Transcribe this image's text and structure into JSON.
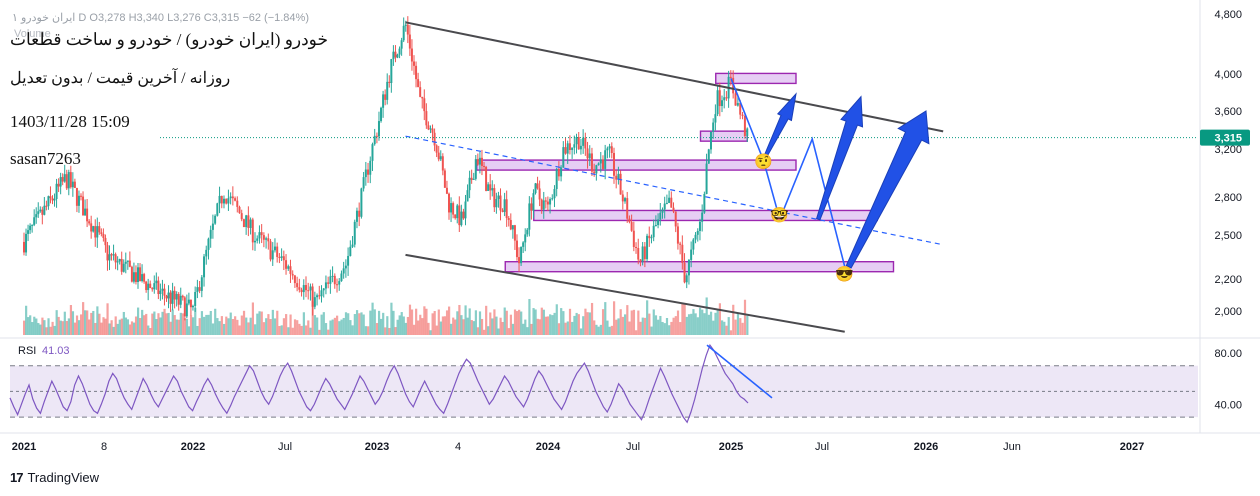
{
  "header": {
    "symbol_line": "خودرو (ایران خودرو) / خودرو و ساخت قطعات",
    "timeframe_line": "روزانه / آخرین قیمت / بدون تعدیل",
    "datetime": "1403/11/28 15:09",
    "author": "sasan7263",
    "ohlc_line": "ایران خودرو ۱ D  O3,278  H3,340  L3,276  C3,315  −62 (−1.84%)",
    "volume_label": "Volume"
  },
  "branding": {
    "logo": "17",
    "name": "TradingView"
  },
  "colors": {
    "candle_up": "#26a69a",
    "candle_down": "#ef5350",
    "channel": "#4a4a4e",
    "trend": "#2962ff",
    "zone_fill": "#e2c6f2",
    "zone_border": "#9c27b0",
    "arrow": "#2151e6",
    "rsi_line": "#7e57c2",
    "rsi_band": "#ede7f6",
    "last_price": "#089981"
  },
  "chart_data": [
    {
      "type": "candlestick",
      "x_ticks": [
        "2021",
        "8",
        "2022",
        "Jul",
        "2023",
        "4",
        "2024",
        "Jul",
        "2025",
        "Jul",
        "2026",
        "Jun",
        "2027"
      ],
      "y_ticks": [
        "4,800",
        "4,000",
        "3,600",
        "3,200",
        "2,800",
        "2,500",
        "2,200",
        "2,000"
      ],
      "ylim": [
        1880,
        4800
      ],
      "last_price": "3,315",
      "price_path": [
        [
          "2021-01",
          2450
        ],
        [
          "2021-04",
          2950
        ],
        [
          "2021-07",
          2350
        ],
        [
          "2021-10",
          2150
        ],
        [
          "2022-01",
          2000
        ],
        [
          "2022-03",
          2850
        ],
        [
          "2022-05",
          2500
        ],
        [
          "2022-07",
          2300
        ],
        [
          "2022-09",
          2050
        ],
        [
          "2022-11",
          2300
        ],
        [
          "2022-12",
          2800
        ],
        [
          "2023-01",
          3400
        ],
        [
          "2023-02",
          4100
        ],
        [
          "2023-03",
          4650
        ],
        [
          "2023-04",
          3700
        ],
        [
          "2023-05",
          3350
        ],
        [
          "2023-06",
          2750
        ],
        [
          "2023-07",
          2600
        ],
        [
          "2023-08",
          3150
        ],
        [
          "2023-09",
          2800
        ],
        [
          "2023-10",
          2750
        ],
        [
          "2023-11",
          2300
        ],
        [
          "2023-12",
          2850
        ],
        [
          "2024-01",
          2700
        ],
        [
          "2024-02",
          3200
        ],
        [
          "2024-03",
          3300
        ],
        [
          "2024-04",
          3050
        ],
        [
          "2024-05",
          3150
        ],
        [
          "2024-06",
          2750
        ],
        [
          "2024-07",
          2300
        ],
        [
          "2024-08",
          2550
        ],
        [
          "2024-09",
          2750
        ],
        [
          "2024-10",
          2200
        ],
        [
          "2024-11",
          2600
        ],
        [
          "2024-12",
          3700
        ],
        [
          "2025-01",
          3900
        ],
        [
          "2025-02",
          3315
        ]
      ],
      "zones": [
        {
          "from": "2024-12",
          "to": "2025-05",
          "price": 3950
        },
        {
          "from": "2024-11",
          "to": "2025-02",
          "price": 3330
        },
        {
          "from": "2023-08",
          "to": "2025-05",
          "price": 3060
        },
        {
          "from": "2023-12",
          "to": "2025-10",
          "price": 2650
        },
        {
          "from": "2023-10",
          "to": "2025-11",
          "price": 2280
        }
      ],
      "channel_upper": [
        [
          "2023-03",
          4680
        ],
        [
          "2026-02",
          3380
        ]
      ],
      "channel_lower": [
        [
          "2023-03",
          2360
        ],
        [
          "2025-08",
          1880
        ]
      ],
      "mid_trendline": [
        [
          "2023-03",
          3330
        ],
        [
          "2026-02",
          2430
        ]
      ],
      "projection_path": [
        [
          "2025-01",
          3950
        ],
        [
          "2025-03",
          3100
        ],
        [
          "2025-04",
          2620
        ],
        [
          "2025-06",
          3300
        ],
        [
          "2025-08",
          2280
        ]
      ],
      "projection_targets": [
        [
          "2025-05",
          3780
        ],
        [
          "2025-09",
          3750
        ],
        [
          "2026-01",
          3600
        ]
      ],
      "emojis": [
        "🤨",
        "🤓",
        "😎"
      ]
    },
    {
      "type": "line",
      "name": "RSI",
      "value_label": "RSI",
      "value": "41.03",
      "y_ticks": [
        "80.00",
        "40.00"
      ],
      "ylim": [
        20,
        90
      ],
      "levels": [
        70,
        50,
        30
      ],
      "values": [
        45,
        38,
        32,
        40,
        48,
        55,
        44,
        37,
        33,
        42,
        50,
        58,
        52,
        45,
        38,
        35,
        42,
        55,
        62,
        56,
        48,
        40,
        35,
        33,
        40,
        48,
        58,
        64,
        60,
        52,
        45,
        40,
        36,
        44,
        52,
        60,
        55,
        48,
        42,
        38,
        44,
        50,
        56,
        62,
        58,
        50,
        44,
        38,
        35,
        42,
        48,
        55,
        60,
        55,
        48,
        42,
        37,
        33,
        39,
        46,
        52,
        58,
        64,
        70,
        66,
        58,
        50,
        44,
        40,
        46,
        54,
        62,
        68,
        72,
        66,
        58,
        50,
        44,
        38,
        35,
        40,
        47,
        54,
        60,
        56,
        50,
        44,
        40,
        36,
        42,
        48,
        55,
        62,
        58,
        52,
        46,
        40,
        44,
        50,
        58,
        65,
        70,
        64,
        56,
        48,
        42,
        38,
        45,
        52,
        58,
        52,
        46,
        40,
        36,
        33,
        40,
        48,
        56,
        64,
        70,
        75,
        72,
        65,
        58,
        52,
        46,
        40,
        44,
        50,
        56,
        62,
        58,
        52,
        46,
        42,
        38,
        44,
        52,
        60,
        66,
        62,
        56,
        50,
        44,
        40,
        36,
        42,
        50,
        58,
        64,
        68,
        72,
        66,
        58,
        50,
        44,
        38,
        34,
        40,
        48,
        56,
        52,
        46,
        40,
        36,
        32,
        28,
        35,
        44,
        52,
        60,
        68,
        62,
        55,
        48,
        42,
        36,
        30,
        26,
        34,
        44,
        56,
        68,
        78,
        86,
        82,
        76,
        70,
        64,
        60,
        56,
        50,
        46,
        44,
        41
      ],
      "trendline": [
        [
          86,
          -1
        ],
        [
          72,
          45
        ]
      ]
    }
  ]
}
